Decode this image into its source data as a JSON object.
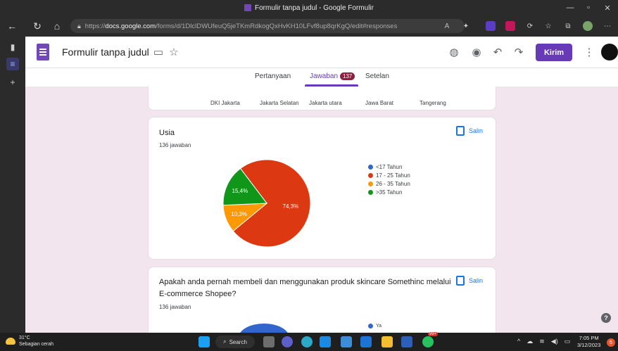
{
  "window": {
    "title": "Formulir tanpa judul - Google Formulir"
  },
  "browser": {
    "url_prefix": "https://",
    "url_host": "docs.google.com",
    "url_path": "/forms/d/1DlclDWUfeuQ5jeTKmRdkogQxHvKH10LFvf8up8qrKgQ/edit#responses"
  },
  "header": {
    "form_title": "Formulir tanpa judul",
    "send_label": "Kirim"
  },
  "tabs": {
    "questions": "Pertanyaan",
    "responses": "Jawaban",
    "responses_count": "137",
    "settings": "Setelan"
  },
  "prev_card": {
    "categories": [
      "DKI Jakarta",
      "Jakarta Selatan",
      "Jakarta utara",
      "Jawa Barat",
      "Tangerang"
    ]
  },
  "card_usia": {
    "title": "Usia",
    "subtitle": "136 jawaban",
    "copy_label": "Salin"
  },
  "card_next": {
    "title_line1": "Apakah anda pernah membeli dan menggunakan produk skincare Somethinc melalui",
    "title_line2": "E-commerce Shopee?",
    "subtitle": "136 jawaban",
    "copy_label": "Salin",
    "legend_partial": "Ya"
  },
  "chart_data": {
    "type": "pie",
    "title": "Usia",
    "legend_position": "right",
    "slices": [
      {
        "label": "<17 Tahun",
        "value": 0,
        "value_label": "",
        "color": "#3366cc"
      },
      {
        "label": "17 - 25 Tahun",
        "value": 74.3,
        "value_label": "74,3%",
        "color": "#dc3912"
      },
      {
        "label": "26 - 35 Tahun",
        "value": 10.3,
        "value_label": "10,3%",
        "color": "#ff9900"
      },
      {
        "label": ">35 Tahun",
        "value": 15.4,
        "value_label": "15,4%",
        "color": "#109618"
      }
    ]
  },
  "taskbar": {
    "temp": "31°C",
    "weather": "Sebagian cerah",
    "search_label": "Search",
    "time": "7:05 PM",
    "date": "3/12/2023",
    "notification_count": "99+",
    "notif_dot": "5"
  },
  "colors": {
    "accent": "#673ab7",
    "link": "#1a73e8",
    "page_bg": "#f3e5ed"
  }
}
